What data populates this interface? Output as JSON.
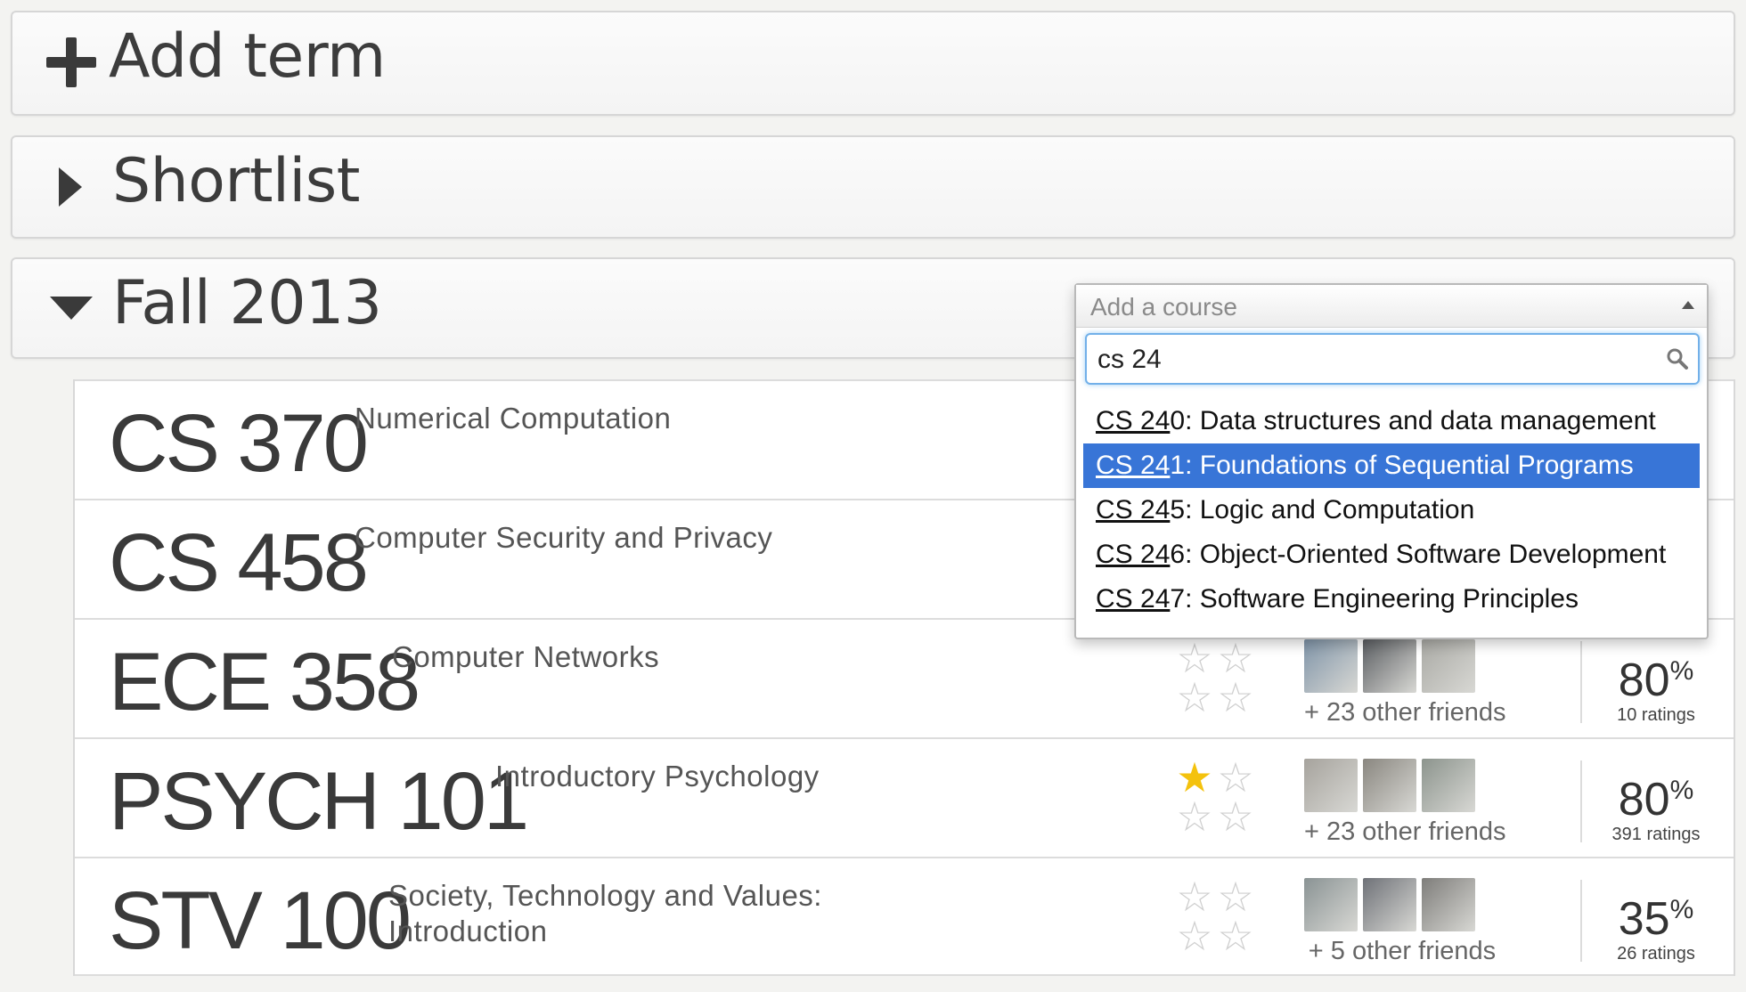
{
  "add_term": {
    "label": "Add term"
  },
  "shortlist": {
    "label": "Shortlist"
  },
  "term": {
    "label": "Fall 2013"
  },
  "course_picker": {
    "placeholder": "Add a course",
    "query": "cs 24",
    "results": [
      {
        "match": "CS 24",
        "rest": "0: Data structures and data management",
        "selected": false
      },
      {
        "match": "CS 24",
        "rest": "1: Foundations of Sequential Programs",
        "selected": true
      },
      {
        "match": "CS 24",
        "rest": "5: Logic and Computation",
        "selected": false
      },
      {
        "match": "CS 24",
        "rest": "6: Object-Oriented Software Development",
        "selected": false
      },
      {
        "match": "CS 24",
        "rest": "7: Software Engineering Principles",
        "selected": false
      }
    ]
  },
  "courses": [
    {
      "code": "CS 370",
      "name": "Numerical Computation"
    },
    {
      "code": "CS 458",
      "name": "Computer Security and Privacy"
    },
    {
      "code": "ECE 358",
      "name": "Computer Networks",
      "stars_filled": 0,
      "friends": "+ 23 other friends",
      "rating": "80",
      "rating_unit": "%",
      "ratings": "10 ratings",
      "avatar_colors": [
        "#7f94a8",
        "#5b5e62",
        "#a9a9a4"
      ]
    },
    {
      "code": "PSYCH 101",
      "name": "Introductory Psychology",
      "stars_filled": 1,
      "friends": "+ 23 other friends",
      "rating": "80",
      "rating_unit": "%",
      "ratings": "391 ratings",
      "avatar_colors": [
        "#a6a39d",
        "#8a8780",
        "#8c948d"
      ]
    },
    {
      "code": "STV 100",
      "name_line1": "Society, Technology and Values:",
      "name_line2": "Introduction",
      "stars_filled": 0,
      "friends": "+ 5 other friends",
      "rating": "35",
      "rating_unit": "%",
      "ratings": "26 ratings",
      "avatar_colors": [
        "#8a9394",
        "#6f7278",
        "#7e7d7a"
      ]
    }
  ],
  "colors": {
    "accent": "#3875d7",
    "star": "#f4c20d",
    "focus": "#72b0e9"
  }
}
